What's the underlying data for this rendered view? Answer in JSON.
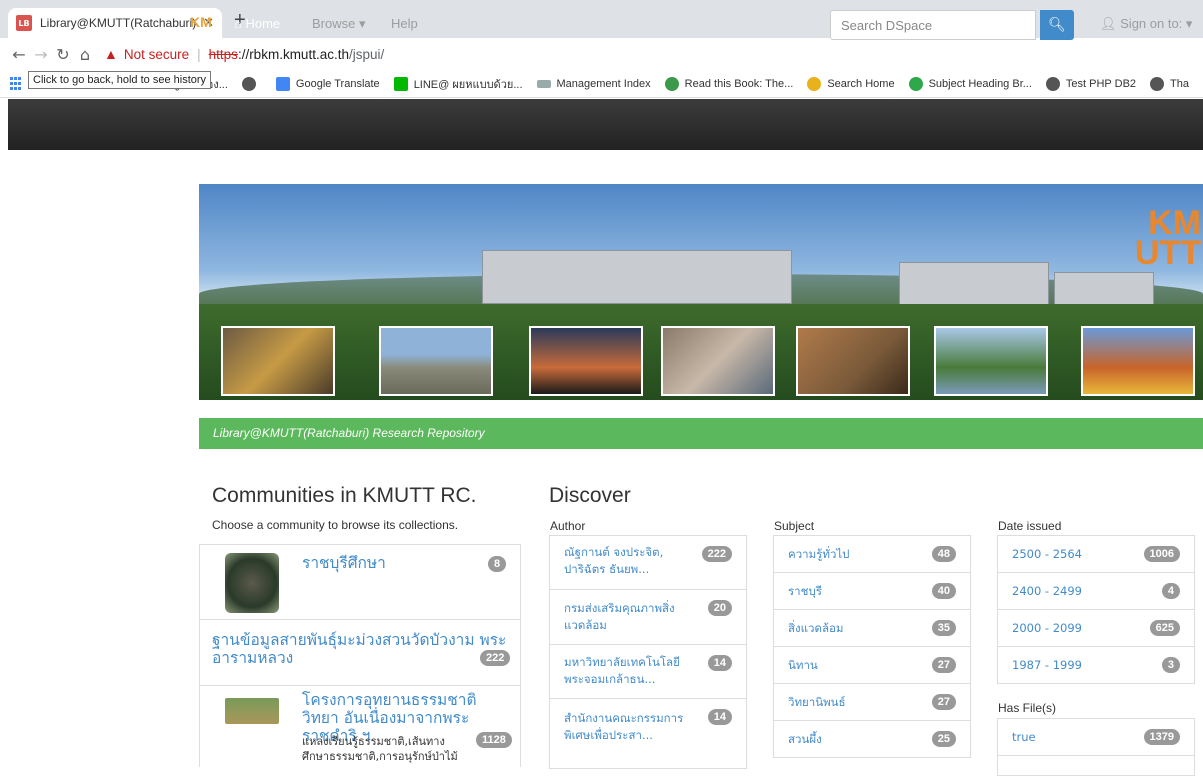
{
  "browser": {
    "tab_title": "Library@KMUTT(Ratchaburi) Res",
    "tab_favicon_text": "LB",
    "new_tab": "+",
    "not_secure": "Not secure",
    "url_protocol": "https",
    "url_host": "://rbkm.kmutt.ac.th",
    "url_path": "/jspui/",
    "tooltip": "Click to go back, hold to see history",
    "bookmarks": [
      "แหล่งสำคัญของห้อง...",
      "Google Translate",
      "LINE@ ผยหแบบด้วย...",
      "Management Index",
      "Read this Book: The...",
      "Search Home",
      "Subject Heading Br...",
      "Test PHP DB2",
      "Tha"
    ]
  },
  "navbar": {
    "home": "Home",
    "browse": "Browse",
    "help": "Help",
    "search_placeholder": "Search DSpace",
    "sign_on": "Sign on to:"
  },
  "banner": {
    "logo_top": "KM",
    "logo_bottom": "UTT"
  },
  "repository_title": "Library@KMUTT(Ratchaburi) Research Repository",
  "communities": {
    "heading": "Communities in KMUTT RC.",
    "subheading": "Choose a community to browse its collections.",
    "items": [
      {
        "title": "ราชบุรีศึกษา",
        "count": "8"
      },
      {
        "title": "ฐานข้อมูลสายพันธุ์มะม่วงสวนวัดบัวงาม พระอารามหลวง",
        "count": "222"
      },
      {
        "title": "โครงการอุทยานธรรมชาติวิทยา อันเนื่องมาจากพระราชดำริ ฯ",
        "count": "1128",
        "description": "แหล่งเรียนรู้ธรรมชาติ,เส้นทางศึกษาธรรมชาติ,การอนุรักษ์ป่าไม้"
      }
    ]
  },
  "discover": {
    "heading": "Discover",
    "author": {
      "label": "Author",
      "items": [
        {
          "text": "ณัฐกานต์ จงประจิต, ปาริฉัตร ธันยพ...",
          "count": "222"
        },
        {
          "text": "กรมส่งเสริมคุณภาพสิ่งแวดล้อม",
          "count": "20"
        },
        {
          "text": "มหาวิทยาลัยเทคโนโลยีพระจอมเกล้าธน...",
          "count": "14"
        },
        {
          "text": "สำนักงานคณะกรรมการพิเศษเพื่อประสา...",
          "count": "14"
        }
      ]
    },
    "subject": {
      "label": "Subject",
      "items": [
        {
          "text": "ความรู้ทั่วไป",
          "count": "48"
        },
        {
          "text": "ราชบุรี",
          "count": "40"
        },
        {
          "text": "สิ่งแวดล้อม",
          "count": "35"
        },
        {
          "text": "นิทาน",
          "count": "27"
        },
        {
          "text": "วิทยานิพนธ์",
          "count": "27"
        },
        {
          "text": "สวนผึ้ง",
          "count": "25"
        }
      ]
    },
    "date_issued": {
      "label": "Date issued",
      "items": [
        {
          "text": "2500 - 2564",
          "count": "1006"
        },
        {
          "text": "2400 - 2499",
          "count": "4"
        },
        {
          "text": "2000 - 2099",
          "count": "625"
        },
        {
          "text": "1987 - 1999",
          "count": "3"
        }
      ]
    },
    "has_files": {
      "label": "Has File(s)",
      "items": [
        {
          "text": "true",
          "count": "1379"
        }
      ]
    }
  }
}
